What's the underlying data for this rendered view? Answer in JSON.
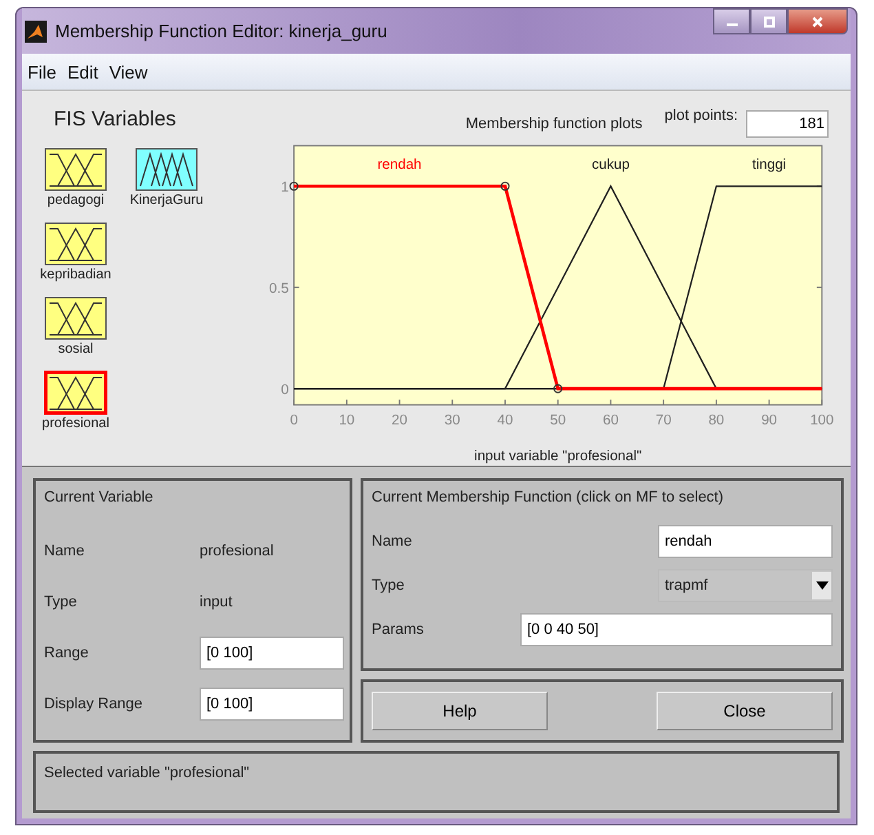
{
  "window": {
    "title": "Membership Function Editor: kinerja_guru"
  },
  "menu": [
    "File",
    "Edit",
    "View"
  ],
  "fis_variables": {
    "title": "FIS Variables",
    "items": [
      {
        "name": "pedagogi",
        "kind": "input",
        "selected": false
      },
      {
        "name": "KinerjaGuru",
        "kind": "output",
        "selected": false
      },
      {
        "name": "kepribadian",
        "kind": "input",
        "selected": false
      },
      {
        "name": "sosial",
        "kind": "input",
        "selected": false
      },
      {
        "name": "profesional",
        "kind": "input",
        "selected": true
      }
    ]
  },
  "plot": {
    "plot_points_label": "plot points:",
    "plot_points": "181",
    "chart_data": {
      "type": "line",
      "title": "Membership function plots",
      "xlabel": "input variable \"profesional\"",
      "x": [
        0,
        10,
        20,
        30,
        40,
        50,
        60,
        70,
        80,
        90,
        100
      ],
      "series": [
        {
          "name": "rendah",
          "color": "#ff0000",
          "values": [
            1,
            1,
            1,
            1,
            1,
            0,
            0,
            0,
            0,
            0,
            0
          ]
        },
        {
          "name": "cukup",
          "color": "#202020",
          "values": [
            0,
            0,
            0,
            0,
            0,
            0.5,
            1,
            0.5,
            0,
            0,
            0
          ]
        },
        {
          "name": "tinggi",
          "color": "#202020",
          "values": [
            0,
            0,
            0,
            0,
            0,
            0,
            0,
            0,
            1,
            1,
            1
          ]
        }
      ],
      "xlim": [
        0,
        100
      ],
      "ylim": [
        -0.08,
        1.2
      ],
      "xticks": [
        0,
        10,
        20,
        30,
        40,
        50,
        60,
        70,
        80,
        90,
        100
      ],
      "yticks": [
        0,
        0.5,
        1
      ]
    }
  },
  "current_variable": {
    "title": "Current Variable",
    "rows": [
      {
        "label": "Name",
        "kind": "text",
        "value": "profesional"
      },
      {
        "label": "Type",
        "kind": "text",
        "value": "input"
      },
      {
        "label": "Range",
        "kind": "field",
        "value": "[0 100]"
      },
      {
        "label": "Display Range",
        "kind": "field",
        "value": "[0 100]"
      }
    ]
  },
  "current_mf": {
    "title": "Current Membership Function (click on MF to select)",
    "rows": [
      {
        "label": "Name",
        "kind": "field",
        "value": "rendah"
      },
      {
        "label": "Type",
        "kind": "dropdown",
        "value": "trapmf"
      },
      {
        "label": "Params",
        "kind": "wide_field",
        "value": "[0 0 40 50]"
      }
    ]
  },
  "buttons": [
    "Help",
    "Close"
  ],
  "status": "Selected variable \"profesional\""
}
